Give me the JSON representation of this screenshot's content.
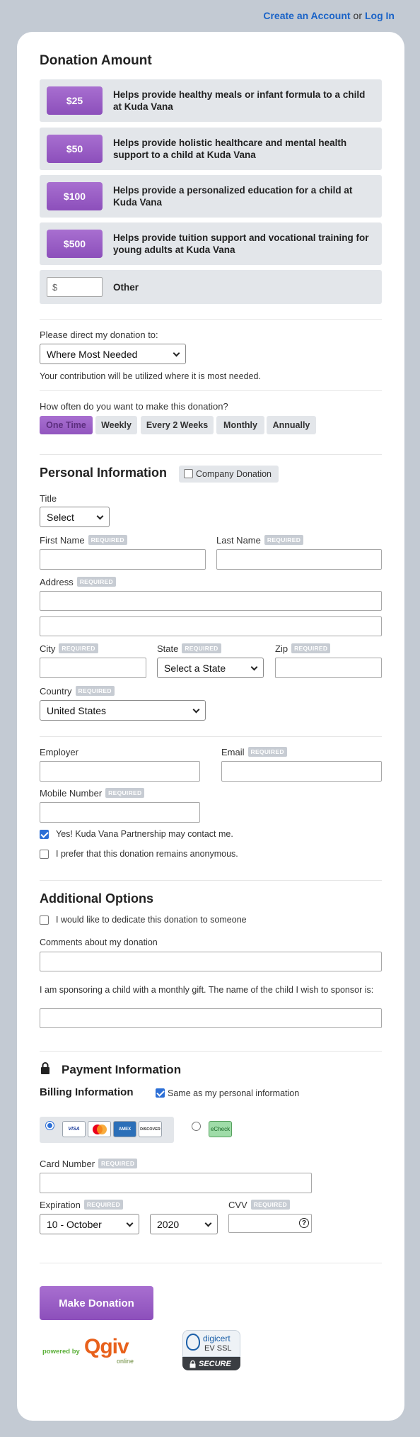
{
  "nav": {
    "create_account": "Create an Account",
    "or": "or",
    "log_in": "Log In"
  },
  "donation": {
    "title": "Donation Amount",
    "options": [
      {
        "amount": "$25",
        "text": "Helps provide healthy meals or infant formula to a child at Kuda Vana"
      },
      {
        "amount": "$50",
        "text": "Helps provide holistic healthcare and mental health support to a child at Kuda Vana"
      },
      {
        "amount": "$100",
        "text": "Helps provide a personalized education for a child at Kuda Vana"
      },
      {
        "amount": "$500",
        "text": "Helps provide tuition support and vocational training for young adults at Kuda Vana"
      }
    ],
    "other_prefix": "$",
    "other_label": "Other"
  },
  "direct": {
    "label": "Please direct my donation to:",
    "value": "Where Most Needed",
    "note": "Your contribution will be utilized where it is most needed."
  },
  "frequency": {
    "label": "How often do you want to make this donation?",
    "options": [
      "One Time",
      "Weekly",
      "Every 2 Weeks",
      "Monthly",
      "Annually"
    ],
    "selected": "One Time"
  },
  "personal": {
    "title": "Personal Information",
    "company": "Company Donation",
    "title_label": "Title",
    "title_value": "Select",
    "first": "First Name",
    "last": "Last Name",
    "address": "Address",
    "city": "City",
    "state": "State",
    "state_value": "Select a State",
    "zip": "Zip",
    "country": "Country",
    "country_value": "United States",
    "employer": "Employer",
    "email": "Email",
    "mobile": "Mobile Number",
    "required": "REQUIRED",
    "contact": "Yes! Kuda Vana Partnership may contact me.",
    "anonymous": "I prefer that this donation remains anonymous."
  },
  "additional": {
    "title": "Additional Options",
    "dedicate": "I would like to dedicate this donation to someone",
    "comments": "Comments about my donation",
    "sponsor": "I am sponsoring a child with a monthly gift. The name of the child I wish to sponsor is:"
  },
  "payment": {
    "title": "Payment Information",
    "billing": "Billing Information",
    "same": "Same as my personal information",
    "cards": [
      "VISA",
      "MC",
      "AMEX",
      "DISCOVER"
    ],
    "echeck": "eCheck",
    "card_number": "Card Number",
    "expiration": "Expiration",
    "month": "10 - October",
    "year": "2020",
    "cvv": "CVV"
  },
  "submit": "Make Donation",
  "footer": {
    "powered": "powered by",
    "brand": "Qgiv",
    "online": "online",
    "digicert": "digicert",
    "ev": "EV SSL",
    "secure": "SECURE"
  },
  "colors": {
    "accent": "#9b5fc8",
    "link": "#1a63c7",
    "page_bg": "#c3cad3"
  }
}
